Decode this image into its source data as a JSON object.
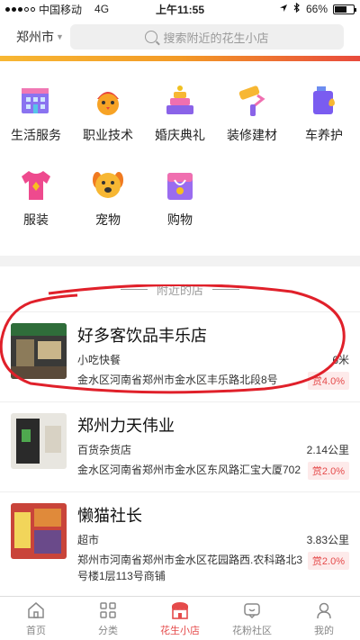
{
  "status_bar": {
    "carrier": "中国移动",
    "network": "4G",
    "time": "上午11:55",
    "battery": "66%",
    "battery_level": 0.66
  },
  "header": {
    "city": "郑州市",
    "search_placeholder": "搜索附近的花生小店"
  },
  "categories": [
    {
      "label": "生活服务",
      "icon": "building-icon"
    },
    {
      "label": "职业技术",
      "icon": "bird-icon"
    },
    {
      "label": "婚庆典礼",
      "icon": "cake-icon"
    },
    {
      "label": "装修建材",
      "icon": "paint-roller-icon"
    },
    {
      "label": "车养护",
      "icon": "oil-can-icon"
    },
    {
      "label": "服装",
      "icon": "tshirt-icon"
    },
    {
      "label": "宠物",
      "icon": "dog-icon"
    },
    {
      "label": "购物",
      "icon": "shopping-bag-icon"
    }
  ],
  "nearby": {
    "title": "附近的店",
    "stores": [
      {
        "name": "好多客饮品丰乐店",
        "type": "小吃快餐",
        "distance": "6米",
        "address": "金水区河南省郑州市金水区丰乐路北段8号",
        "reward": "赏4.0%"
      },
      {
        "name": "郑州力天伟业",
        "type": "百货杂货店",
        "distance": "2.14公里",
        "address": "金水区河南省郑州市金水区东风路汇宝大厦702",
        "reward": "赏2.0%"
      },
      {
        "name": "懒猫社长",
        "type": "超市",
        "distance": "3.83公里",
        "address": "郑州市河南省郑州市金水区花园路西.农科路北3号楼1层113号商铺",
        "reward": "赏2.0%"
      }
    ]
  },
  "tabbar": {
    "tabs": [
      {
        "label": "首页",
        "icon": "home-icon"
      },
      {
        "label": "分类",
        "icon": "grid-icon"
      },
      {
        "label": "花生小店",
        "icon": "store-icon",
        "active": true
      },
      {
        "label": "花粉社区",
        "icon": "chat-icon"
      },
      {
        "label": "我的",
        "icon": "user-icon"
      }
    ]
  },
  "colors": {
    "accent": "#e54b4b",
    "strip_start": "#f7b733",
    "strip_end": "#e84a3c"
  }
}
